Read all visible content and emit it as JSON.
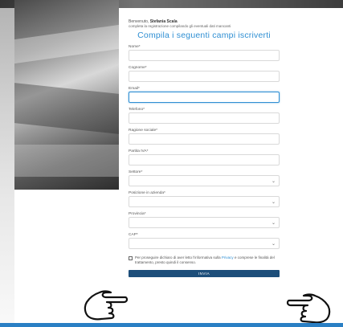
{
  "header": {
    "greeting_prefix": "Benvenuto,",
    "user_name": "Stefania Scala",
    "subtitle": "completa la registrazione compilando gli eventuali dati mancanti",
    "title": "Compila i seguenti campi iscriverti"
  },
  "fields": [
    {
      "label": "Nome*",
      "value": ""
    },
    {
      "label": "Cognome*",
      "value": ""
    },
    {
      "label": "Email*",
      "value": ""
    },
    {
      "label": "Telefono*",
      "value": ""
    },
    {
      "label": "Ragione sociale*",
      "value": ""
    },
    {
      "label": "Partita IVA*",
      "value": ""
    },
    {
      "label": "Settore*",
      "value": ""
    },
    {
      "label": "Posizione in azienda*",
      "value": ""
    },
    {
      "label": "Provincia*",
      "value": ""
    },
    {
      "label": "CAP*",
      "value": ""
    }
  ],
  "consent": {
    "text_before": "Per proseguire dichiaro di aver letto l'informativa sulla ",
    "link": "Privacy",
    "text_after": " e comprese le finalità del trattamento, presto quindi il consenso."
  },
  "submit": {
    "label": "INVIA"
  },
  "colors": {
    "accent": "#2f8fd3",
    "button": "#1d4e7a",
    "bottom_bar": "#2a7fc4"
  },
  "icons": {
    "select_chevron": "chevron-down-icon",
    "pointing_hand": "pointing-hand-icon"
  }
}
